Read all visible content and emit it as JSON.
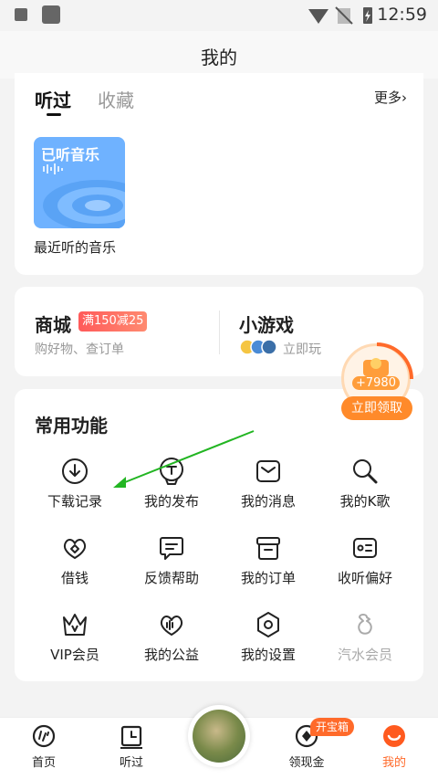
{
  "status_bar": {
    "time": "12:59"
  },
  "header": {
    "title": "我的"
  },
  "history": {
    "tabs": [
      {
        "label": "听过"
      },
      {
        "label": "收藏"
      }
    ],
    "more_label": "更多",
    "cover_title": "已听音乐",
    "cover_caption": "最近听的音乐"
  },
  "mall": {
    "title": "商城",
    "badge": "满150减25",
    "subtitle": "购好物、查订单"
  },
  "games": {
    "title": "小游戏",
    "subtitle": "立即玩"
  },
  "floating_widget": {
    "amount": "+7980",
    "button_label": "立即领取"
  },
  "functions": {
    "title": "常用功能",
    "items": [
      {
        "label": "下载记录",
        "icon": "download-icon"
      },
      {
        "label": "我的发布",
        "icon": "publish-icon"
      },
      {
        "label": "我的消息",
        "icon": "message-icon"
      },
      {
        "label": "我的K歌",
        "icon": "karaoke-mic-icon"
      },
      {
        "label": "借钱",
        "icon": "loan-icon"
      },
      {
        "label": "反馈帮助",
        "icon": "feedback-icon"
      },
      {
        "label": "我的订单",
        "icon": "order-icon"
      },
      {
        "label": "收听偏好",
        "icon": "preference-icon"
      },
      {
        "label": "VIP会员",
        "icon": "vip-crown-icon"
      },
      {
        "label": "我的公益",
        "icon": "charity-heart-icon"
      },
      {
        "label": "我的设置",
        "icon": "settings-hexagon-icon"
      },
      {
        "label": "汽水会员",
        "icon": "soda-member-icon"
      }
    ]
  },
  "bottom_nav": {
    "items": [
      {
        "label": "首页",
        "icon": "home-icon"
      },
      {
        "label": "听过",
        "icon": "history-icon"
      },
      {
        "label": "领现金",
        "icon": "cash-icon"
      },
      {
        "label": "我的",
        "icon": "profile-icon"
      }
    ],
    "badge": "开宝箱"
  },
  "colors": {
    "accent": "#ff6a2a",
    "annotation_arrow": "#22b522",
    "cover_blue": "#6fb2ff"
  }
}
